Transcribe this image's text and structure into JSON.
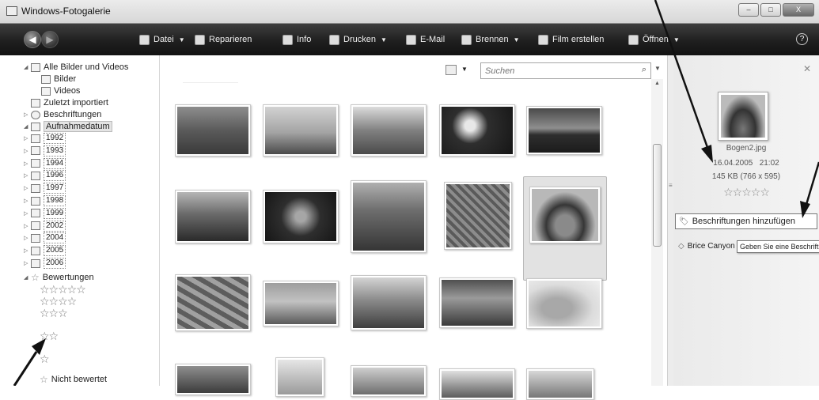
{
  "window": {
    "title": "Windows-Fotogalerie",
    "buttons": [
      "–",
      "□",
      "X"
    ]
  },
  "toolbar": {
    "items": [
      {
        "label": "Datei",
        "icon": "file-icon",
        "caret": true
      },
      {
        "label": "Reparieren",
        "icon": "fix-icon",
        "caret": false
      },
      {
        "label": "Info",
        "icon": "info-icon",
        "caret": false
      },
      {
        "label": "Drucken",
        "icon": "printer-icon",
        "caret": true
      },
      {
        "label": "E-Mail",
        "icon": "mail-icon",
        "caret": false
      },
      {
        "label": "Brennen",
        "icon": "burn-disc-icon",
        "caret": true
      },
      {
        "label": "Film erstellen",
        "icon": "film-icon",
        "caret": false
      },
      {
        "label": "Öffnen",
        "icon": "open-icon",
        "caret": true
      }
    ],
    "help": "?"
  },
  "navigation": {
    "all_items": "Alle Bilder und Videos",
    "pictures": "Bilder",
    "videos": "Videos",
    "recently_imported": "Zuletzt importiert",
    "tags": "Beschriftungen",
    "date_taken": "Aufnahmedatum",
    "years": [
      "1992",
      "1993",
      "1994",
      "1996",
      "1997",
      "1998",
      "1999",
      "2002",
      "2004",
      "2005",
      "2006"
    ],
    "ratings": "Bewertungen",
    "not_rated": "Nicht bewertet",
    "rating_rows": [
      "☆☆☆☆☆",
      "☆☆☆☆",
      "☆☆☆",
      "☆☆",
      "☆"
    ]
  },
  "search": {
    "placeholder": "Suchen"
  },
  "details": {
    "filename": "Bogen2.jpg",
    "date": "16.04.2005",
    "time": "21:02",
    "size": "145 KB (766 x 595)",
    "rating_stars": "☆☆☆☆☆",
    "rating": 0,
    "add_tags": "Beschriftungen hinzufügen",
    "tag": "Brice Canyon",
    "tooltip": "Geben Sie eine Beschriftung ein"
  },
  "colors": {
    "toolbar": "#1c1f23",
    "selection": "#e2e2e2"
  }
}
